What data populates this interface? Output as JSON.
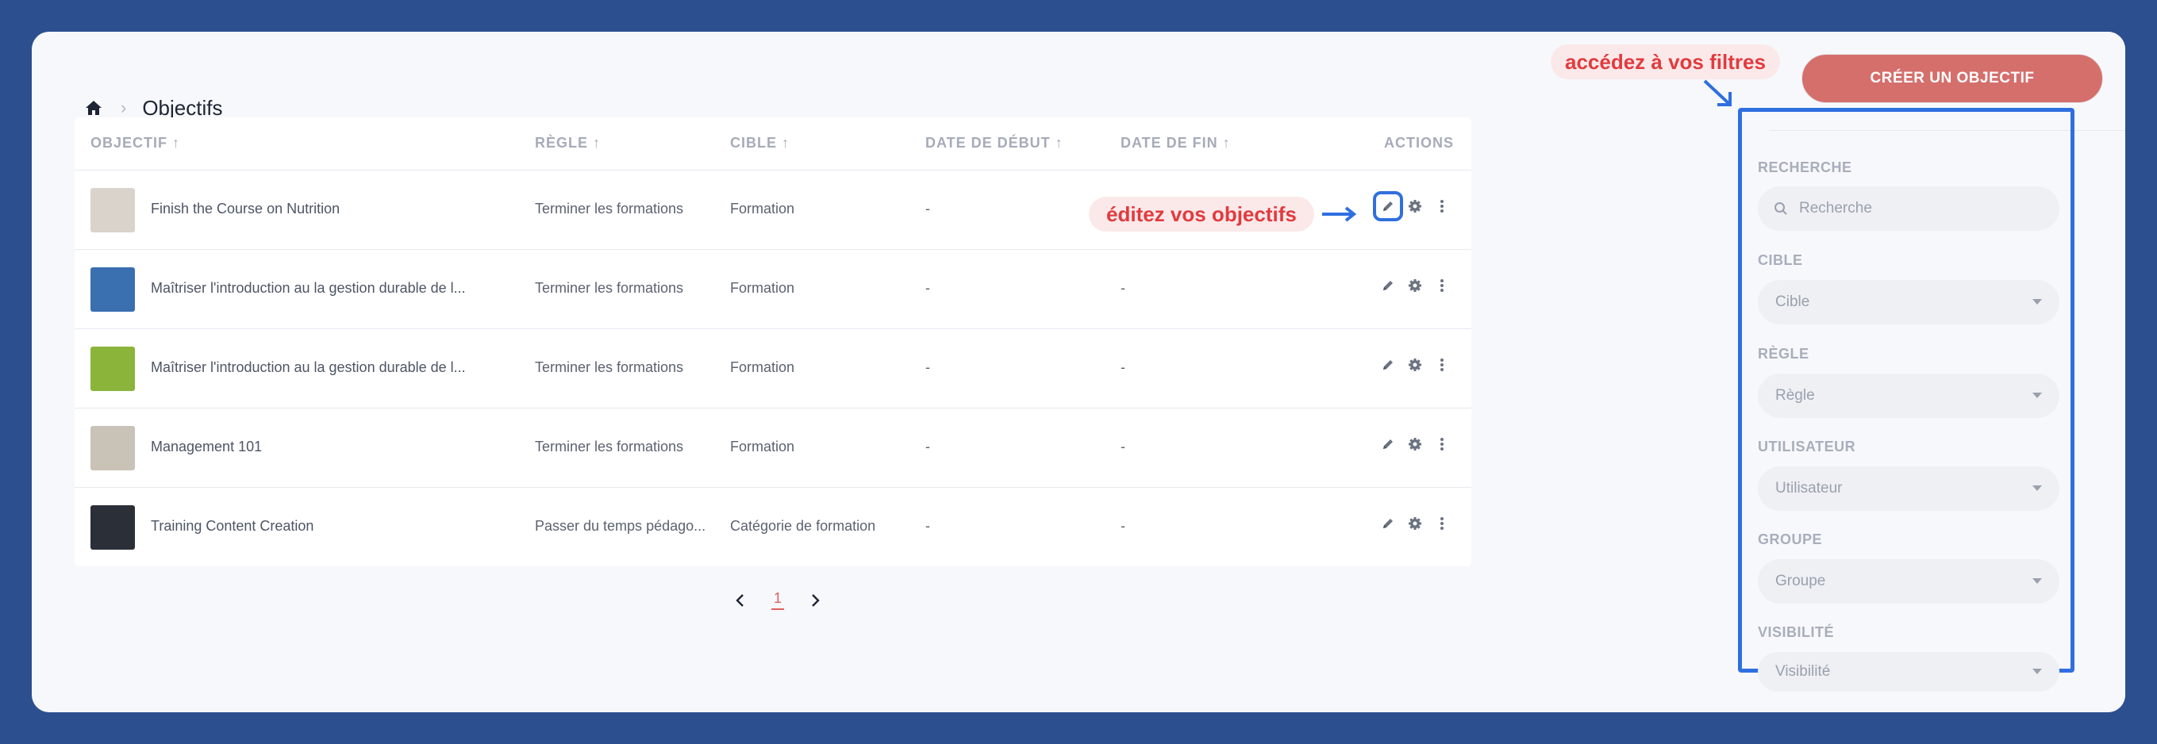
{
  "breadcrumb": {
    "home_icon": "home-icon",
    "title": "Objectifs"
  },
  "table": {
    "headers": {
      "objectif": "OBJECTIF",
      "regle": "RÈGLE",
      "cible": "CIBLE",
      "date_debut": "DATE DE DÉBUT",
      "date_fin": "DATE DE FIN",
      "actions": "ACTIONS"
    },
    "rows": [
      {
        "name": "Finish the Course on Nutrition",
        "regle": "Terminer les formations",
        "cible": "Formation",
        "date_debut": "-",
        "date_fin": "-",
        "thumb_color": "#d9d3cb"
      },
      {
        "name": "Maîtriser l'introduction au la gestion durable de l...",
        "regle": "Terminer les formations",
        "cible": "Formation",
        "date_debut": "-",
        "date_fin": "-",
        "thumb_color": "#3a6fb0"
      },
      {
        "name": "Maîtriser l'introduction au la gestion durable de l...",
        "regle": "Terminer les formations",
        "cible": "Formation",
        "date_debut": "-",
        "date_fin": "-",
        "thumb_color": "#8ab43a"
      },
      {
        "name": "Management 101",
        "regle": "Terminer les formations",
        "cible": "Formation",
        "date_debut": "-",
        "date_fin": "-",
        "thumb_color": "#c9c2b6"
      },
      {
        "name": "Training Content Creation",
        "regle": "Passer du temps pédago...",
        "cible": "Catégorie de formation",
        "date_debut": "-",
        "date_fin": "-",
        "thumb_color": "#2b2f38"
      }
    ]
  },
  "pagination": {
    "current": "1"
  },
  "callouts": {
    "edit": "éditez vos objectifs",
    "filters": "accédez à vos filtres"
  },
  "sidebar": {
    "create_button": "CRÉER UN OBJECTIF",
    "filters": {
      "recherche": {
        "label": "RECHERCHE",
        "placeholder": "Recherche"
      },
      "cible": {
        "label": "CIBLE",
        "placeholder": "Cible"
      },
      "regle": {
        "label": "RÈGLE",
        "placeholder": "Règle"
      },
      "utilisateur": {
        "label": "UTILISATEUR",
        "placeholder": "Utilisateur"
      },
      "groupe": {
        "label": "GROUPE",
        "placeholder": "Groupe"
      },
      "visibilite": {
        "label": "VISIBILITÉ",
        "placeholder": "Visibilité"
      }
    }
  },
  "colors": {
    "accent": "#d56f6c",
    "highlight": "#2f6fe0",
    "callout_text": "#e23b3e",
    "background": "#2c4f8f"
  }
}
